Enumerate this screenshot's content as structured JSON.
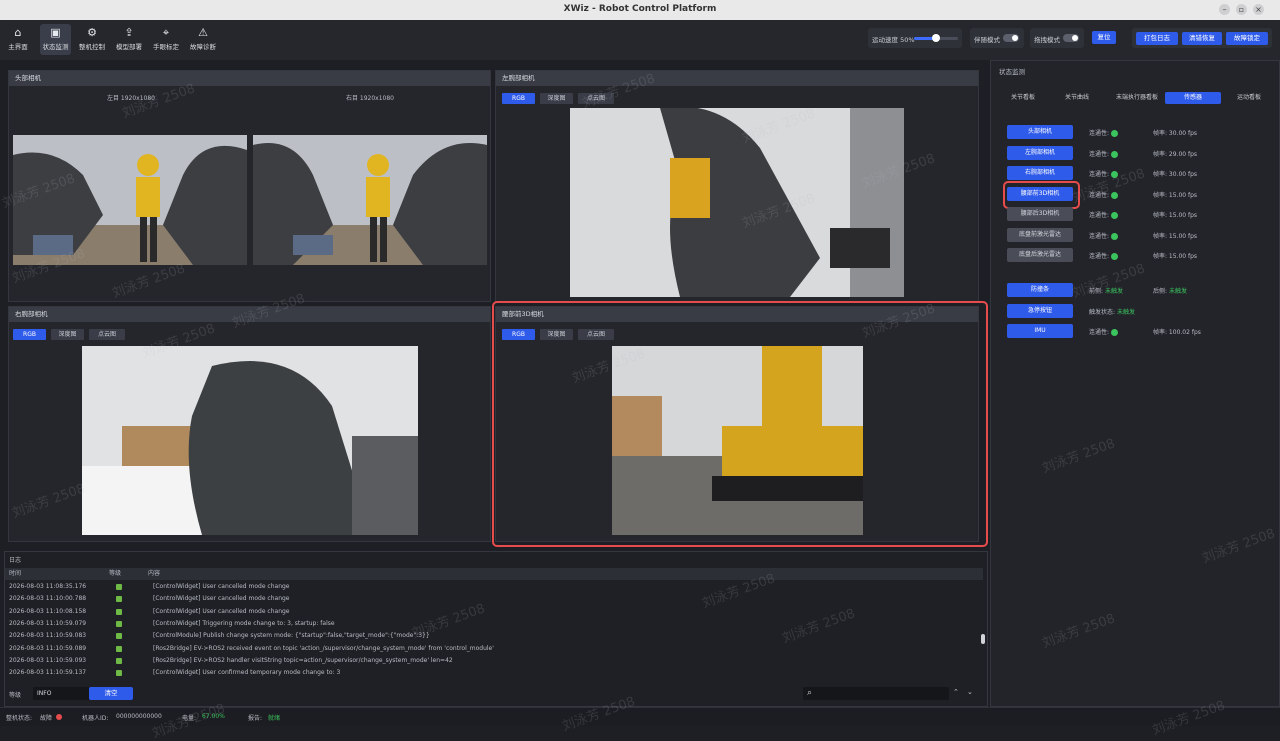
{
  "window": {
    "title": "XWiz - Robot Control Platform",
    "min_icon": "minimize-icon",
    "max_icon": "maximize-icon",
    "close_icon": "close-icon"
  },
  "toolbar": {
    "items": [
      {
        "label": "主界面",
        "icon": "home-icon",
        "glyph": "⌂"
      },
      {
        "label": "状态监测",
        "icon": "monitor-icon",
        "glyph": "▣"
      },
      {
        "label": "整机控制",
        "icon": "robot-control-icon",
        "glyph": "⚙"
      },
      {
        "label": "模型部署",
        "icon": "deploy-icon",
        "glyph": "⇪"
      },
      {
        "label": "手眼标定",
        "icon": "calibration-icon",
        "glyph": "⌖"
      },
      {
        "label": "故障诊断",
        "icon": "diagnosis-icon",
        "glyph": "⚠"
      }
    ],
    "speed_label": "运动速度 50%",
    "speed_value": 50,
    "follow_mode_label": "伴随模式",
    "drag_mode_label": "拖拽模式",
    "reset_label": "复位",
    "open_log_label": "打包日志",
    "clear_fault_label": "清错恢复",
    "fault_lock_label": "故障锁定"
  },
  "cams": {
    "head": {
      "title": "头部相机",
      "left_caption": "左目 1920x1080",
      "right_caption": "右目 1920x1080"
    },
    "left_wrist": {
      "title": "左腕部相机",
      "tabs": [
        "RGB",
        "深度图",
        "点云图"
      ]
    },
    "right_wrist": {
      "title": "右腕部相机",
      "tabs": [
        "RGB",
        "深度图",
        "点云图"
      ]
    },
    "waist_front": {
      "title": "腰部前3D相机",
      "tabs": [
        "RGB",
        "深度图",
        "点云图"
      ]
    }
  },
  "status": {
    "title": "状态监测",
    "tabs": [
      "关节看板",
      "关节曲线",
      "末端执行器看板",
      "传感器",
      "运动看板"
    ],
    "active_tab": 3,
    "sensors": [
      {
        "name": "头部相机",
        "conn_label": "连通性:",
        "rate": "帧率: 30.00 fps",
        "style": "blue"
      },
      {
        "name": "左腕部相机",
        "conn_label": "连通性:",
        "rate": "帧率: 29.00 fps",
        "style": "blue"
      },
      {
        "name": "右腕部相机",
        "conn_label": "连通性:",
        "rate": "帧率: 30.00 fps",
        "style": "blue"
      },
      {
        "name": "腰部前3D相机",
        "conn_label": "连通性:",
        "rate": "帧率: 15.00 fps",
        "style": "blue"
      },
      {
        "name": "腰部后3D相机",
        "conn_label": "连通性:",
        "rate": "帧率: 15.00 fps",
        "style": "gray"
      },
      {
        "name": "底盘前激光雷达",
        "conn_label": "连通性:",
        "rate": "帧率: 15.00 fps",
        "style": "gray"
      },
      {
        "name": "底盘后激光雷达",
        "conn_label": "连通性:",
        "rate": "帧率: 15.00 fps",
        "style": "gray"
      }
    ],
    "collision": {
      "name": "防撞条",
      "front_label": "前侧:",
      "front_value": "未触发",
      "back_label": "后侧:",
      "back_value": "未触发"
    },
    "estop": {
      "name": "急停按钮",
      "label": "触发状态:",
      "value": "未触发"
    },
    "imu": {
      "name": "IMU",
      "conn_label": "连通性:",
      "rate": "帧率: 100.02 fps"
    }
  },
  "log": {
    "title": "日志",
    "headers": [
      "时间",
      "等级",
      "内容"
    ],
    "rows": [
      {
        "time": "2026-08-03 11:08:35.176",
        "content": "[ControlWidget] User cancelled mode change"
      },
      {
        "time": "2026-08-03 11:10:00.788",
        "content": "[ControlWidget] User cancelled mode change"
      },
      {
        "time": "2026-08-03 11:10:08.158",
        "content": "[ControlWidget] User cancelled mode change"
      },
      {
        "time": "2026-08-03 11:10:59.079",
        "content": "[ControlWidget] Triggering mode change to: 3, startup: false"
      },
      {
        "time": "2026-08-03 11:10:59.083",
        "content": "[ControlModule] Publish change system mode: {\"startup\":false,\"target_mode\":{\"mode\":3}}"
      },
      {
        "time": "2026-08-03 11:10:59.089",
        "content": "[Ros2Bridge] EV->ROS2 received event on topic 'action_/supervisor/change_system_mode' from 'control_module'"
      },
      {
        "time": "2026-08-03 11:10:59.093",
        "content": "[Ros2Bridge] EV->ROS2 handler visitString topic=action_/supervisor/change_system_mode' len=42"
      },
      {
        "time": "2026-08-03 11:10:59.137",
        "content": "[ControlWidget] User confirmed temporary mode change to: 3"
      }
    ],
    "level_label": "等级",
    "level_value": "INFO",
    "clear_label": "清空",
    "search_icon": "search-icon"
  },
  "statusbar": {
    "conn_label": "整机状态:",
    "conn_value": "故障",
    "robot_id_label": "机器人ID:",
    "robot_id_value": "000000000000",
    "battery_label": "电量:",
    "battery_value": "67.00%",
    "alarm_label": "报告:",
    "alarm_value": "就绪"
  },
  "watermark": "刘泳芳 2508",
  "colors": {
    "accent": "#2f5bea",
    "highlight": "#e74c4c",
    "ok": "#3bc45e",
    "panel": "#25262c"
  }
}
